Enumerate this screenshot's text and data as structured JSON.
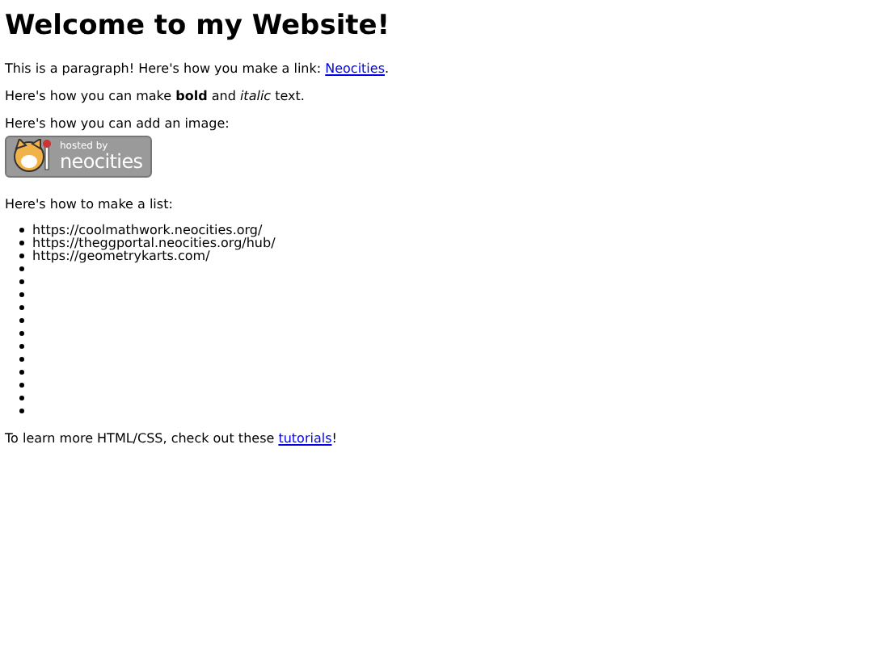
{
  "heading": "Welcome to my Website!",
  "link_paragraph": {
    "before": "This is a paragraph! Here's how you make a link: ",
    "link": "Neocities",
    "after": "."
  },
  "styled_paragraph": "Here's how you can make **bold** and *italic* text.",
  "image_intro": "Here's how you can add an image:",
  "badge": {
    "line_1": "hosted by",
    "line_2": "neocities"
  },
  "list_intro": "Here's how to make a list:",
  "list_items": [
    {
      "kind": "text",
      "text": "https://coolmathwork.neocities.org/"
    },
    {
      "kind": "text",
      "text": "https://theggportal.neocities.org/hub/"
    },
    {
      "kind": "text",
      "text": "https://geometrykarts.com/"
    },
    {
      "kind": "blank"
    },
    {
      "kind": "blank"
    },
    {
      "kind": "blank"
    },
    {
      "kind": "blank"
    },
    {
      "kind": "blank"
    },
    {
      "kind": "blank"
    },
    {
      "kind": "blank"
    },
    {
      "kind": "blank"
    },
    {
      "kind": "blank"
    },
    {
      "kind": "blank"
    },
    {
      "kind": "blank"
    },
    {
      "kind": "blank"
    }
  ],
  "footer_paragraph": {
    "before": "To learn more HTML/CSS, check out these ",
    "link": "tutorials",
    "after": "!"
  }
}
